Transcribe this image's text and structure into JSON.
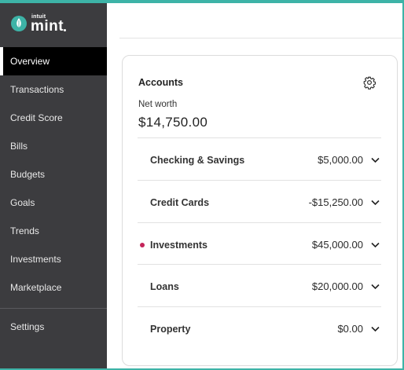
{
  "brand": {
    "company": "intuit",
    "product": "mint",
    "colors": {
      "accent": "#3db3a7",
      "sidebar": "#3c3c3f",
      "alert_dot": "#c4245a"
    }
  },
  "sidebar": {
    "items": [
      {
        "label": "Overview",
        "active": true
      },
      {
        "label": "Transactions"
      },
      {
        "label": "Credit Score"
      },
      {
        "label": "Bills"
      },
      {
        "label": "Budgets"
      },
      {
        "label": "Goals"
      },
      {
        "label": "Trends"
      },
      {
        "label": "Investments"
      },
      {
        "label": "Marketplace"
      }
    ],
    "settings_label": "Settings"
  },
  "accounts": {
    "title": "Accounts",
    "settings_icon": "gear-icon",
    "net_worth_label": "Net worth",
    "net_worth_value": "$14,750.00",
    "rows": [
      {
        "name": "Checking & Savings",
        "amount": "$5,000.00",
        "icon": "chevron-down-icon"
      },
      {
        "name": "Credit Cards",
        "amount": "-$15,250.00",
        "icon": "chevron-down-icon"
      },
      {
        "name": "Investments",
        "amount": "$45,000.00",
        "icon": "chevron-down-icon",
        "alert": true
      },
      {
        "name": "Loans",
        "amount": "$20,000.00",
        "icon": "chevron-down-icon"
      },
      {
        "name": "Property",
        "amount": "$0.00",
        "icon": "chevron-down-icon"
      }
    ]
  }
}
